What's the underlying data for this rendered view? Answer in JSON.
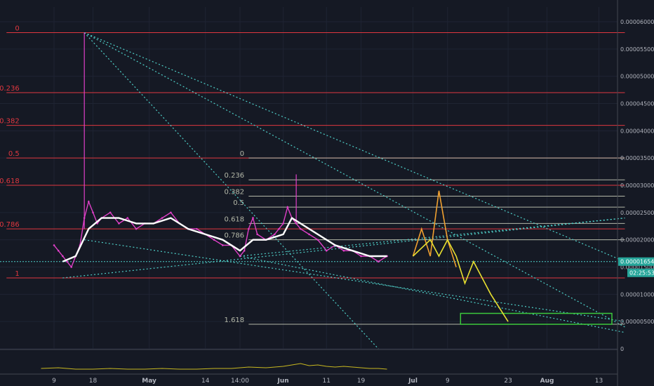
{
  "chart_data": {
    "type": "line",
    "title": "",
    "xlabel": "",
    "ylabel": "",
    "ylim": [
      0,
      6.2e-06
    ],
    "x_ticks": [
      {
        "label": "9",
        "day": 9
      },
      {
        "label": "18",
        "day": 18
      },
      {
        "label": "May",
        "day": 31,
        "bold": true
      },
      {
        "label": "14",
        "day": 44
      },
      {
        "label": "14:00",
        "day": 52
      },
      {
        "label": "Jun",
        "day": 62,
        "bold": true
      },
      {
        "label": "11",
        "day": 72
      },
      {
        "label": "19",
        "day": 80
      },
      {
        "label": "Jul",
        "day": 92,
        "bold": true
      },
      {
        "label": "9",
        "day": 100
      },
      {
        "label": "23",
        "day": 114
      },
      {
        "label": "Aug",
        "day": 123,
        "bold": true
      },
      {
        "label": "13",
        "day": 135
      }
    ],
    "y_ticks": [
      "0.00006000",
      "0.00005500",
      "0.00005000",
      "0.00004500",
      "0.00004000",
      "0.00003500",
      "0.00003000",
      "0.00002500",
      "0.00002000",
      "0.00001500",
      "0.00001000",
      "0.00000500",
      "0"
    ],
    "y_tick_values": [
      6e-06,
      5.5e-06,
      5e-06,
      4.5e-06,
      4e-06,
      3.5e-06,
      3e-06,
      2.5e-06,
      2e-06,
      1.5e-06,
      1e-06,
      5e-07,
      0
    ],
    "current_price": {
      "label": "0.00001654",
      "value": 1.6e-06
    },
    "countdown": "02:25:53",
    "colors": {
      "price": "#e040c8",
      "ma": "#ffffff",
      "fib1": "#e0373f",
      "fib2": "#b4b8a8",
      "trend": "#4fd0c9",
      "proj_orange": "#f0a030",
      "proj_yellow": "#e8e030",
      "target_box": "#3cc83c",
      "volume": "#c8b820",
      "background": "#151924",
      "axis_text": "#b2b5be"
    },
    "series": [
      {
        "name": "",
        "x": [
          9,
          10,
          11,
          12,
          13,
          14,
          15,
          16,
          17,
          18,
          19,
          20,
          22,
          24,
          26,
          28,
          30,
          32,
          34,
          36,
          38,
          40,
          42,
          44,
          46,
          48,
          50,
          52,
          53,
          54,
          55,
          56,
          58,
          60,
          61,
          62,
          63,
          64,
          65,
          66,
          68,
          70,
          72,
          74,
          76,
          78,
          80,
          82,
          84,
          86
        ],
        "y": [
          1.9e-06,
          1.8e-06,
          1.7e-06,
          1.6e-06,
          1.5e-06,
          1.7e-06,
          1.9e-06,
          2.4e-06,
          2.7e-06,
          2.5e-06,
          2.3e-06,
          2.4e-06,
          2.5e-06,
          2.3e-06,
          2.4e-06,
          2.2e-06,
          2.3e-06,
          2.3e-06,
          2.4e-06,
          2.5e-06,
          2.3e-06,
          2.2e-06,
          2.2e-06,
          2.1e-06,
          2e-06,
          1.9e-06,
          1.9e-06,
          1.7e-06,
          1.8e-06,
          2.2e-06,
          2.4e-06,
          2.1e-06,
          2e-06,
          2.1e-06,
          2.2e-06,
          2.3e-06,
          2.6e-06,
          2.4e-06,
          2.3e-06,
          2.2e-06,
          2.1e-06,
          2e-06,
          1.8e-06,
          1.9e-06,
          1.8e-06,
          1.8e-06,
          1.7e-06,
          1.7e-06,
          1.6e-06,
          1.7e-06
        ]
      },
      {
        "name": "",
        "x": [
          11,
          14,
          17,
          20,
          24,
          28,
          32,
          36,
          40,
          44,
          48,
          52,
          55,
          58,
          62,
          64,
          66,
          70,
          74,
          78,
          82,
          86
        ],
        "y": [
          1.6e-06,
          1.7e-06,
          2.2e-06,
          2.4e-06,
          2.4e-06,
          2.3e-06,
          2.3e-06,
          2.4e-06,
          2.2e-06,
          2.1e-06,
          2e-06,
          1.8e-06,
          2e-06,
          2e-06,
          2.1e-06,
          2.4e-06,
          2.3e-06,
          2.1e-06,
          1.9e-06,
          1.8e-06,
          1.7e-06,
          1.7e-06
        ]
      }
    ],
    "spikes": [
      {
        "x": 16,
        "low": 2.2e-06,
        "high": 5.8e-06
      },
      {
        "x": 65,
        "low": 2.3e-06,
        "high": 3.2e-06
      }
    ],
    "fib_sets": [
      {
        "x_from": -2,
        "x_to": 141,
        "label_x": 1,
        "levels": [
          {
            "label": "0",
            "value": 5.8e-06
          },
          {
            "label": "0.236",
            "value": 4.7e-06
          },
          {
            "label": "0.382",
            "value": 4.1e-06
          },
          {
            "label": "0.5",
            "value": 3.5e-06
          },
          {
            "label": "0.618",
            "value": 3e-06
          },
          {
            "label": "0.786",
            "value": 2.2e-06
          },
          {
            "label": "1",
            "value": 1.3e-06
          }
        ]
      },
      {
        "x_from": 54,
        "x_to": 141,
        "label_x": 53,
        "levels": [
          {
            "label": "0",
            "value": 3.5e-06
          },
          {
            "label": "0.236",
            "value": 3.1e-06
          },
          {
            "label": "0.382",
            "value": 2.8e-06
          },
          {
            "label": "0.5",
            "value": 2.6e-06
          },
          {
            "label": "0.618",
            "value": 2.3e-06
          },
          {
            "label": "0.786",
            "value": 2e-06
          },
          {
            "label": "1.618",
            "value": 4.5e-07
          }
        ]
      }
    ],
    "trendlines": [
      {
        "x1": 16,
        "y1": 5.8e-06,
        "x2": 141,
        "y2": 4e-07
      },
      {
        "x1": 16,
        "y1": 5.8e-06,
        "x2": 84,
        "y2": 0.0
      },
      {
        "x1": 16,
        "y1": 5.8e-06,
        "x2": 141,
        "y2": 1.6e-06
      },
      {
        "x1": 11,
        "y1": 1.3e-06,
        "x2": 141,
        "y2": 2.4e-06
      },
      {
        "x1": 52,
        "y1": 1.7e-06,
        "x2": 141,
        "y2": 2.4e-06
      },
      {
        "x1": 16,
        "y1": 2e-06,
        "x2": 141,
        "y2": 5e-07
      },
      {
        "x1": 52,
        "y1": 1.7e-06,
        "x2": 141,
        "y2": 3e-07
      }
    ],
    "projection_orange": {
      "x": [
        92,
        94,
        96,
        98,
        100,
        102
      ],
      "y": [
        1.7e-06,
        2.2e-06,
        1.7e-06,
        2.9e-06,
        2e-06,
        1.5e-06
      ]
    },
    "projection_yellow": {
      "x": [
        92,
        96,
        98,
        100,
        102,
        104,
        106,
        108,
        110,
        114
      ],
      "y": [
        1.7e-06,
        2e-06,
        1.7e-06,
        2e-06,
        1.7e-06,
        1.2e-06,
        1.6e-06,
        1.3e-06,
        1e-06,
        5e-07
      ]
    },
    "target_box": {
      "x1": 103,
      "x2": 138,
      "y1": 4.5e-07,
      "y2": 6.5e-07
    },
    "volume": {
      "x": [
        6,
        10,
        14,
        18,
        22,
        26,
        30,
        34,
        38,
        42,
        46,
        50,
        54,
        58,
        62,
        64,
        66,
        68,
        70,
        72,
        74,
        76,
        78,
        80,
        82,
        84,
        86
      ],
      "v": [
        0.3,
        0.4,
        0.2,
        0.2,
        0.3,
        0.2,
        0.2,
        0.3,
        0.2,
        0.2,
        0.3,
        0.3,
        0.5,
        0.4,
        0.6,
        0.8,
        1.0,
        0.7,
        0.8,
        0.6,
        0.5,
        0.6,
        0.5,
        0.4,
        0.3,
        0.3,
        0.2
      ]
    }
  }
}
